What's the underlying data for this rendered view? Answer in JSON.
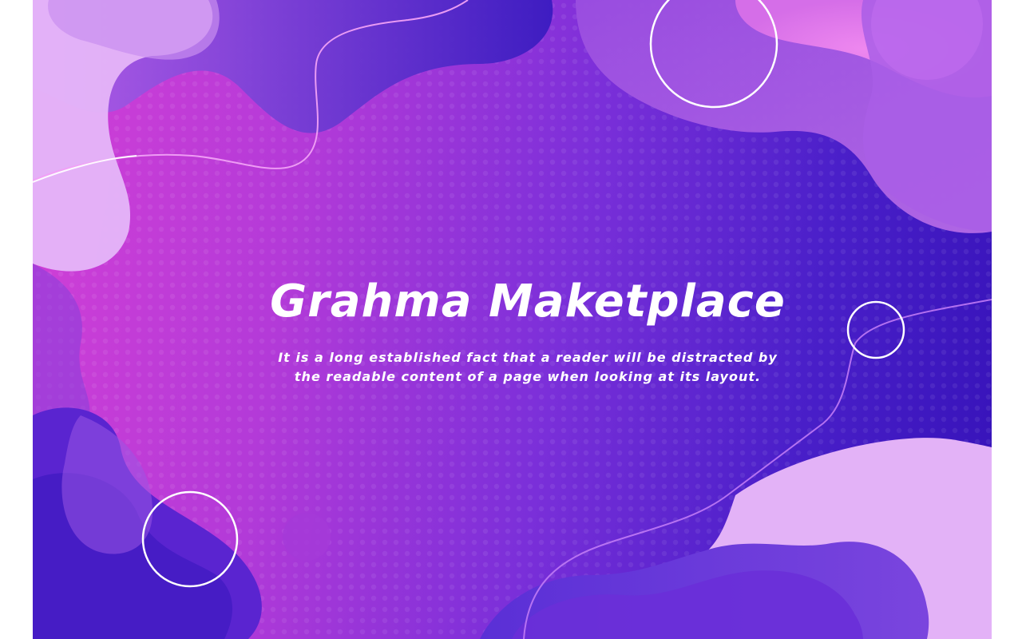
{
  "hero": {
    "title": "Grahma Maketplace",
    "text_line_1": "It is a long established fact that a reader will be distracted by",
    "text_line_2": "the readable content of a page when looking at its layout."
  },
  "colors": {
    "gradient_start": "#d33fd6",
    "gradient_end": "#3512b8",
    "text": "#ffffff",
    "blob_light": "#e2aaf6",
    "blob_violet": "#6a33d8"
  }
}
